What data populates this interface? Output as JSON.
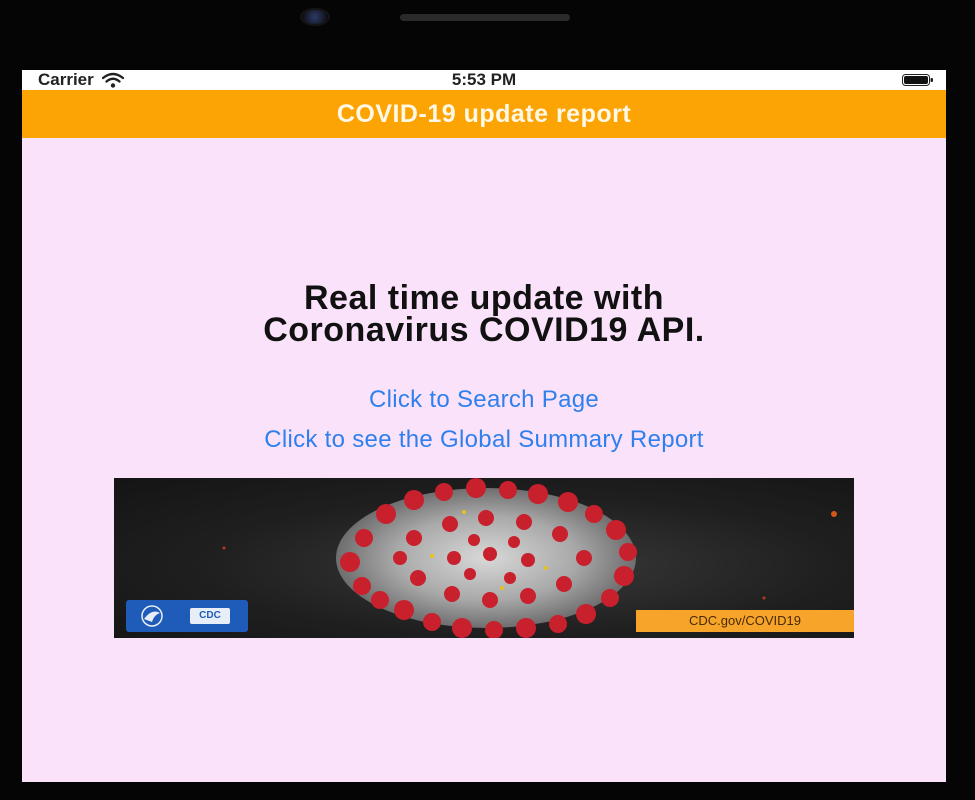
{
  "status_bar": {
    "carrier": "Carrier",
    "time": "5:53 PM",
    "wifi_icon": "wifi-icon",
    "battery_icon": "battery-icon"
  },
  "nav": {
    "title": "COVID-19 update report"
  },
  "main": {
    "headline_line1": "Real time update with",
    "headline_line2": "Coronavirus COVID19 API.",
    "link_search": "Click to Search Page",
    "link_global": "Click to see the Global Summary Report"
  },
  "banner": {
    "logo_text": "CDC",
    "url_text": "CDC.gov/COVID19"
  },
  "colors": {
    "nav_background": "#fca404",
    "screen_background": "#fbe2fb",
    "link": "#2f80ed"
  }
}
